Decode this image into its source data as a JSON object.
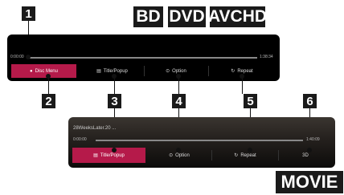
{
  "labels": {
    "bd": "BD",
    "dvd": "DVD",
    "avchd": "AVCHD",
    "movie": "MOVIE"
  },
  "callouts": [
    "1",
    "2",
    "3",
    "4",
    "5",
    "6"
  ],
  "top_panel": {
    "time_start": "0:00:00",
    "time_end": "1:38:34",
    "buttons": [
      {
        "label": "Disc Menu",
        "icon": "disc-icon",
        "active": true
      },
      {
        "label": "Title/Popup",
        "icon": "title-icon",
        "active": false
      },
      {
        "label": "Option",
        "icon": "option-icon",
        "active": false
      },
      {
        "label": "Repeat",
        "icon": "repeat-icon",
        "active": false
      }
    ]
  },
  "bottom_panel": {
    "file_title": "28WeeksLater.20 ...",
    "time_start": "0:00:00",
    "time_end": "1:40:09",
    "buttons": [
      {
        "label": "Title/Popup",
        "icon": "title-icon",
        "active": true
      },
      {
        "label": "Option",
        "icon": "option-icon",
        "active": false
      },
      {
        "label": "Repeat",
        "icon": "repeat-icon",
        "active": false
      },
      {
        "label": "3D",
        "icon": "3d-icon",
        "active": false
      }
    ]
  },
  "colors": {
    "accent": "#b51a4a",
    "badge": "#1a1a1a"
  }
}
